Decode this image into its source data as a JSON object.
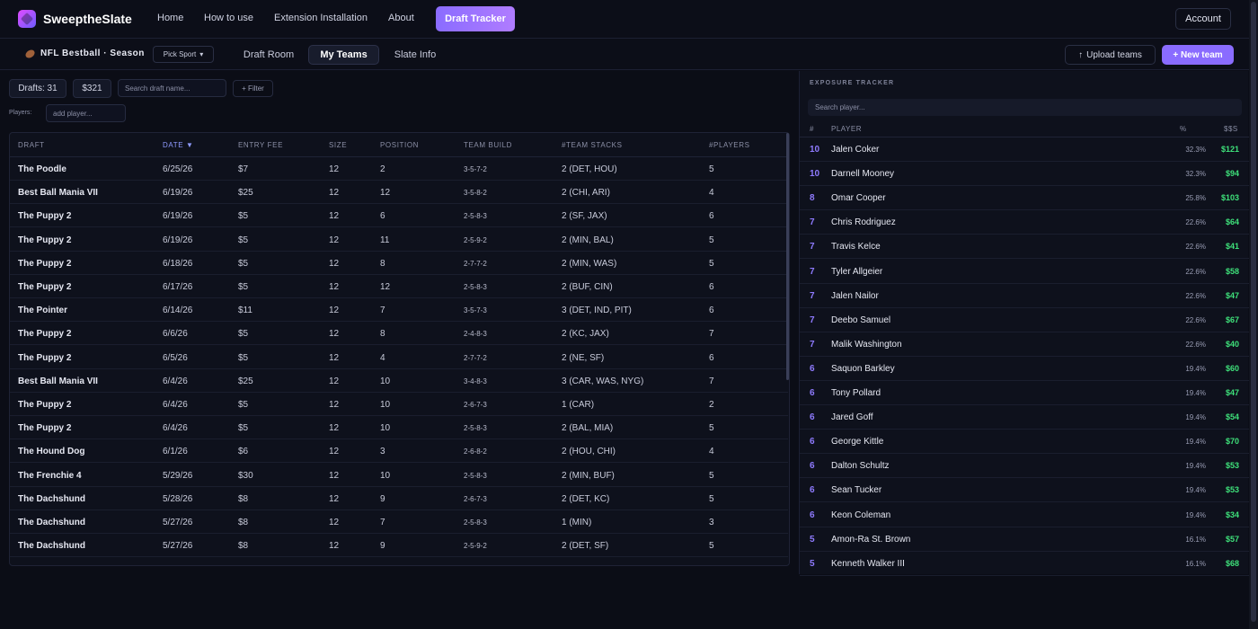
{
  "app": {
    "name": "SweeptheSlate"
  },
  "nav": {
    "links": [
      "Home",
      "How to use",
      "Extension Installation",
      "About"
    ],
    "draft_tracker": "Draft Tracker",
    "account": "Account"
  },
  "subnav": {
    "sport_label": "NFL Bestball · Season",
    "pick_sport": "Pick Sport",
    "tabs": [
      "Draft Room",
      "My Teams",
      "Slate Info"
    ],
    "active_tab": "My Teams",
    "upload": "Upload teams",
    "new_team": "+ New team"
  },
  "controls": {
    "drafts_label": "Drafts:",
    "drafts_count": "31",
    "total_fees": "$321",
    "search_placeholder": "Search draft name...",
    "filter": "+ Filter",
    "players_label": "Players:",
    "add_player_placeholder": "add player..."
  },
  "table": {
    "headers": [
      "DRAFT",
      "DATE ▼",
      "ENTRY FEE",
      "SIZE",
      "POSITION",
      "TEAM BUILD",
      "#TEAM STACKS",
      "#PLAYERS"
    ],
    "rows": [
      [
        "The Poodle",
        "6/25/26",
        "$7",
        "12",
        "2",
        "3-5-7-2",
        "2 (DET, HOU)",
        "5"
      ],
      [
        "Best Ball Mania VII",
        "6/19/26",
        "$25",
        "12",
        "12",
        "3-5-8-2",
        "2 (CHI, ARI)",
        "4"
      ],
      [
        "The Puppy 2",
        "6/19/26",
        "$5",
        "12",
        "6",
        "2-5-8-3",
        "2 (SF, JAX)",
        "6"
      ],
      [
        "The Puppy 2",
        "6/19/26",
        "$5",
        "12",
        "11",
        "2-5-9-2",
        "2 (MIN, BAL)",
        "5"
      ],
      [
        "The Puppy 2",
        "6/18/26",
        "$5",
        "12",
        "8",
        "2-7-7-2",
        "2 (MIN, WAS)",
        "5"
      ],
      [
        "The Puppy 2",
        "6/17/26",
        "$5",
        "12",
        "12",
        "2-5-8-3",
        "2 (BUF, CIN)",
        "6"
      ],
      [
        "The Pointer",
        "6/14/26",
        "$11",
        "12",
        "7",
        "3-5-7-3",
        "3 (DET, IND, PIT)",
        "6"
      ],
      [
        "The Puppy 2",
        "6/6/26",
        "$5",
        "12",
        "8",
        "2-4-8-3",
        "2 (KC, JAX)",
        "7"
      ],
      [
        "The Puppy 2",
        "6/5/26",
        "$5",
        "12",
        "4",
        "2-7-7-2",
        "2 (NE, SF)",
        "6"
      ],
      [
        "Best Ball Mania VII",
        "6/4/26",
        "$25",
        "12",
        "10",
        "3-4-8-3",
        "3 (CAR, WAS, NYG)",
        "7"
      ],
      [
        "The Puppy 2",
        "6/4/26",
        "$5",
        "12",
        "10",
        "2-6-7-3",
        "1 (CAR)",
        "2"
      ],
      [
        "The Puppy 2",
        "6/4/26",
        "$5",
        "12",
        "10",
        "2-5-8-3",
        "2 (BAL, MIA)",
        "5"
      ],
      [
        "The Hound Dog",
        "6/1/26",
        "$6",
        "12",
        "3",
        "2-6-8-2",
        "2 (HOU, CHI)",
        "4"
      ],
      [
        "The Frenchie 4",
        "5/29/26",
        "$30",
        "12",
        "10",
        "2-5-8-3",
        "2 (MIN, BUF)",
        "5"
      ],
      [
        "The Dachshund",
        "5/28/26",
        "$8",
        "12",
        "9",
        "2-6-7-3",
        "2 (DET, KC)",
        "5"
      ],
      [
        "The Dachshund",
        "5/27/26",
        "$8",
        "12",
        "7",
        "2-5-8-3",
        "1 (MIN)",
        "3"
      ],
      [
        "The Dachshund",
        "5/27/26",
        "$8",
        "12",
        "9",
        "2-5-9-2",
        "2 (DET, SF)",
        "5"
      ]
    ]
  },
  "exposure": {
    "title": "EXPOSURE TRACKER",
    "search_placeholder": "Search player...",
    "headers": [
      "#",
      "PLAYER",
      "%",
      "$$S"
    ],
    "rows": [
      [
        "10",
        "Jalen Coker",
        "32.3%",
        "$121"
      ],
      [
        "10",
        "Darnell Mooney",
        "32.3%",
        "$94"
      ],
      [
        "8",
        "Omar Cooper",
        "25.8%",
        "$103"
      ],
      [
        "7",
        "Chris Rodriguez",
        "22.6%",
        "$64"
      ],
      [
        "7",
        "Travis Kelce",
        "22.6%",
        "$41"
      ],
      [
        "7",
        "Tyler Allgeier",
        "22.6%",
        "$58"
      ],
      [
        "7",
        "Jalen Nailor",
        "22.6%",
        "$47"
      ],
      [
        "7",
        "Deebo Samuel",
        "22.6%",
        "$67"
      ],
      [
        "7",
        "Malik Washington",
        "22.6%",
        "$40"
      ],
      [
        "6",
        "Saquon Barkley",
        "19.4%",
        "$60"
      ],
      [
        "6",
        "Tony Pollard",
        "19.4%",
        "$47"
      ],
      [
        "6",
        "Jared Goff",
        "19.4%",
        "$54"
      ],
      [
        "6",
        "George Kittle",
        "19.4%",
        "$70"
      ],
      [
        "6",
        "Dalton Schultz",
        "19.4%",
        "$53"
      ],
      [
        "6",
        "Sean Tucker",
        "19.4%",
        "$53"
      ],
      [
        "6",
        "Keon Coleman",
        "19.4%",
        "$34"
      ],
      [
        "5",
        "Amon-Ra St. Brown",
        "16.1%",
        "$57"
      ],
      [
        "5",
        "Kenneth Walker III",
        "16.1%",
        "$68"
      ]
    ]
  },
  "colors": {
    "accent": "#8a6cff",
    "money": "#3ee07a",
    "background": "#0b0d16"
  }
}
